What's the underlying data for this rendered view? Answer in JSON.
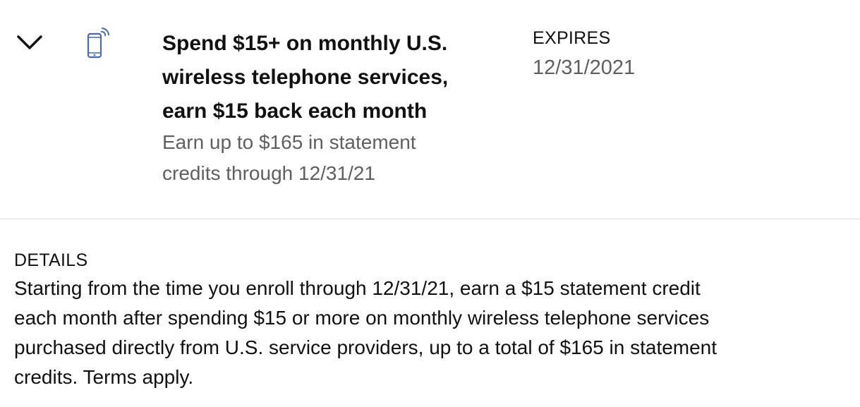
{
  "offer": {
    "icon": "mobile-phone-wireless-icon",
    "title": "Spend $15+ on monthly U.S. wireless telephone services, earn $15 back each month",
    "subtitle": "Earn up to $165 in statement credits through 12/31/21",
    "expires_label": "EXPIRES",
    "expires_date": "12/31/2021",
    "accent_color": "#4a6aa8"
  },
  "details": {
    "label": "DETAILS",
    "body": "Starting from the time you enroll through 12/31/21, earn a $15 statement credit each month after spending $15 or more on monthly wireless telephone services purchased directly from U.S. service providers, up to a total of $165 in statement credits. Terms apply."
  }
}
